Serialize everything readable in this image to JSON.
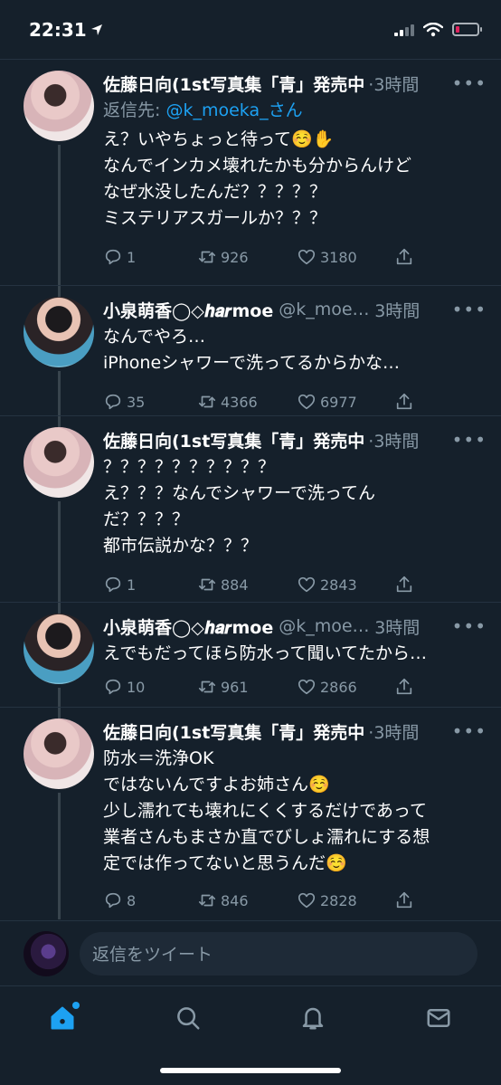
{
  "status_bar": {
    "time": "22:31",
    "battery_color": "#e0245e"
  },
  "colors": {
    "background": "#15202b",
    "accent": "#1da1f2",
    "muted": "#8899a6"
  },
  "tweets": [
    {
      "name": "佐藤日向(1st写真集「青」発売中",
      "handle": "",
      "time": "·3時間",
      "reply_label": "返信先:",
      "reply_mention": "@k_moeka_さん",
      "text": "え？いやちょっと待って☺️✋\nなんでインカメ壊れたかも分からんけど\nなぜ水没したんだ？？？？？\nミステリアスガールか？？？",
      "replies": "1",
      "retweets": "926",
      "likes": "3180"
    },
    {
      "name": "小泉萌香◯◇𝒉𝒂𝒓𝗺𝗼𝗲",
      "handle": "@k_moeka_",
      "time": "3時間",
      "text": "なんでやろ…\niPhoneシャワーで洗ってるからかな…",
      "replies": "35",
      "retweets": "4366",
      "likes": "6977"
    },
    {
      "name": "佐藤日向(1st写真集「青」発売中",
      "handle": "",
      "time": "·3時間",
      "text": "？？？？？？？？？？\nえ？？？なんでシャワーで洗ってん\nだ？？？？\n都市伝説かな？？？",
      "replies": "1",
      "retweets": "884",
      "likes": "2843"
    },
    {
      "name": "小泉萌香◯◇𝒉𝒂𝒓𝗺𝗼𝗲",
      "handle": "@k_moeka_",
      "time": "3時間",
      "text": "えでもだってほら防水って聞いてたから…",
      "replies": "10",
      "retweets": "961",
      "likes": "2866"
    },
    {
      "name": "佐藤日向(1st写真集「青」発売中",
      "handle": "",
      "time": "·3時間",
      "text": "防水＝洗浄OK\nではないんですよお姉さん☺️\n少し濡れても壊れにくくするだけであって\n業者さんもまさか直でびしょ濡れにする想\n定では作ってないと思うんだ☺️",
      "replies": "8",
      "retweets": "846",
      "likes": "2828"
    }
  ],
  "reply_bar": {
    "placeholder": "返信をツイート"
  },
  "tabs": [
    "home-icon",
    "search-icon",
    "bell-icon",
    "mail-icon"
  ]
}
